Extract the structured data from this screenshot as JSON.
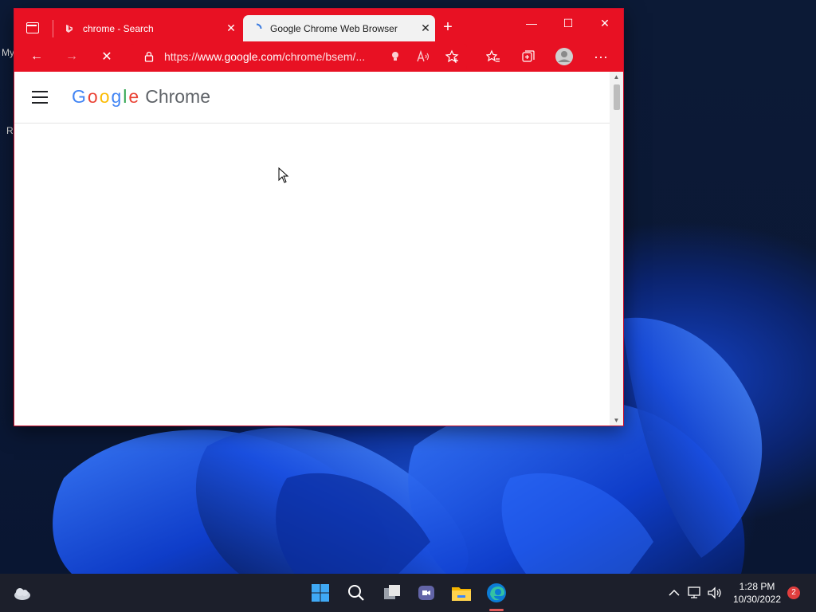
{
  "desktop": {
    "labels": [
      "My",
      "R"
    ]
  },
  "browser": {
    "tabs": [
      {
        "title": "chrome - Search",
        "close": "✕",
        "active": false
      },
      {
        "title": "Google Chrome Web Browser",
        "close": "✕",
        "active": true
      }
    ],
    "new_tab": "+",
    "window_controls": {
      "minimize": "—",
      "maximize": "☐",
      "close": "✕"
    },
    "toolbar": {
      "back": "←",
      "forward": "→",
      "stop": "✕",
      "address": {
        "prefix": "https://",
        "domain": "www.google.com",
        "path": "/chrome/bsem/..."
      },
      "more": "···"
    },
    "page": {
      "logo_letters": [
        "G",
        "o",
        "o",
        "g",
        "l",
        "e"
      ],
      "logo_product": "Chrome"
    }
  },
  "taskbar": {
    "time": "1:28 PM",
    "date": "10/30/2022",
    "notifications": "2"
  },
  "colors": {
    "accent": "#e81123",
    "taskbar": "#1c1f2b"
  }
}
